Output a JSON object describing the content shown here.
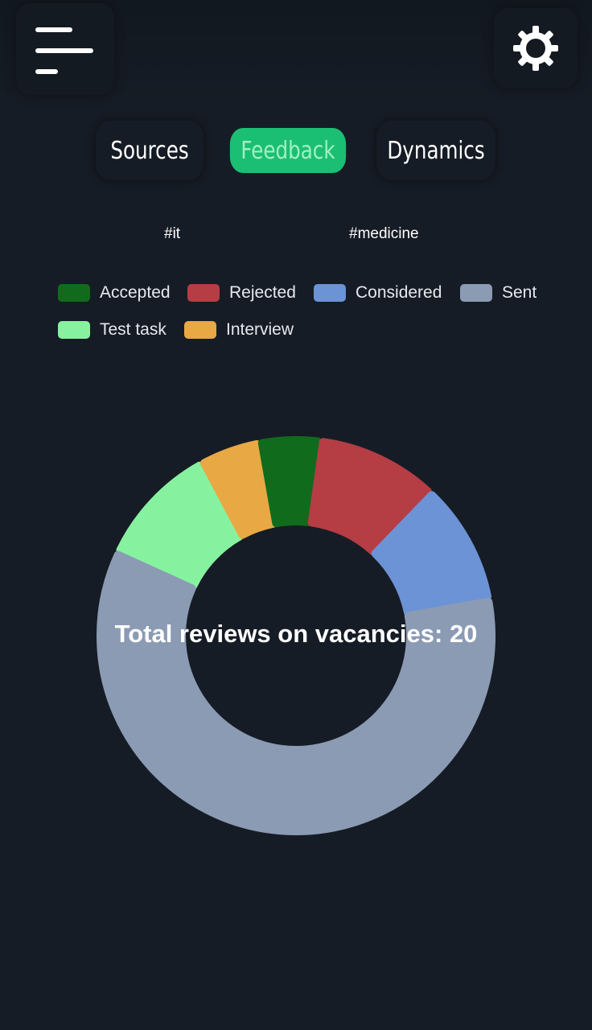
{
  "header": {
    "menu_icon": "hamburger-menu-icon",
    "settings_icon": "gear-icon"
  },
  "tabs": [
    {
      "label": "Sources",
      "active": false
    },
    {
      "label": "Feedback",
      "active": true
    },
    {
      "label": "Dynamics",
      "active": false
    }
  ],
  "filters": [
    {
      "label": "#it"
    },
    {
      "label": "#medicine"
    }
  ],
  "colors": {
    "background": "#161c25",
    "active_tab": "#1bbf73"
  },
  "chart_data": {
    "type": "pie",
    "title": "",
    "center_label": "Total reviews on vacancies: 20",
    "legend_position": "top",
    "categories": [
      "Accepted",
      "Rejected",
      "Considered",
      "Sent",
      "Test task",
      "Interview"
    ],
    "values": [
      1,
      2,
      2,
      12,
      2,
      1
    ],
    "colors": [
      "#116b1c",
      "#b53d44",
      "#6b93d6",
      "#8b9bb4",
      "#86f2a0",
      "#e8a844"
    ]
  }
}
